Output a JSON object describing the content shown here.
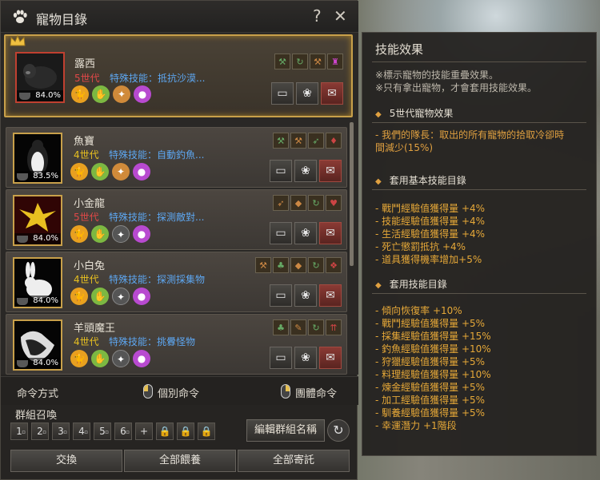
{
  "window": {
    "title": "寵物目錄",
    "help": "?",
    "close": "✕"
  },
  "pets": [
    {
      "name": "露西",
      "generation": "5世代",
      "gen_color": "#e04848",
      "special": "特殊技能：抵抗沙漠...",
      "loyalty": "84.0%",
      "selected": true
    },
    {
      "name": "魚寶",
      "generation": "4世代",
      "gen_color": "#e8c020",
      "special": "特殊技能：自動釣魚...",
      "loyalty": "83.5%",
      "selected": false
    },
    {
      "name": "小金龍",
      "generation": "5世代",
      "gen_color": "#e04848",
      "special": "特殊技能：探測敵對...",
      "loyalty": "84.0%",
      "selected": false
    },
    {
      "name": "小白兔",
      "generation": "4世代",
      "gen_color": "#e8c020",
      "special": "特殊技能：探測採集物",
      "loyalty": "84.0%",
      "selected": false
    },
    {
      "name": "羊頭魔王",
      "generation": "4世代",
      "gen_color": "#e8c020",
      "special": "特殊技能：挑釁怪物",
      "loyalty": "84.0%",
      "selected": false
    }
  ],
  "command": {
    "label": "命令方式",
    "individual": "個別命令",
    "group": "團體命令"
  },
  "group": {
    "label": "群組召喚",
    "slots": [
      "1",
      "2",
      "3",
      "4",
      "5",
      "6",
      "+"
    ],
    "edit_button": "編輯群組名稱",
    "refresh": "↻"
  },
  "bottom": {
    "exchange": "交換",
    "feed_all": "全部餵養",
    "deposit_all": "全部寄託"
  },
  "skill_panel": {
    "title": "技能效果",
    "notes": [
      "※標示寵物的技能重疊效果。",
      "※只有拿出寵物，才會套用技能效果。"
    ],
    "section1": "5世代寵物效果",
    "section1_lines": [
      "- 我們的隊長：取出的所有寵物的拾取冷卻時",
      "間減少(15%)"
    ],
    "section2": "套用基本技能目錄",
    "section2_lines": [
      "- 戰鬥經驗值獲得量 +4%",
      "- 技能經驗值獲得量 +4%",
      "- 生活經驗值獲得量 +4%",
      "- 死亡懲罰抵抗 +4%",
      "- 道具獲得機率增加+5%"
    ],
    "section3": "套用技能目錄",
    "section3_lines": [
      "- 傾向恢復率 +10%",
      "- 戰鬥經驗值獲得量 +5%",
      "- 採集經驗值獲得量 +15%",
      "- 釣魚經驗值獲得量 +10%",
      "- 狩獵經驗值獲得量 +5%",
      "- 料理經驗值獲得量 +10%",
      "- 煉金經驗值獲得量 +5%",
      "- 加工經驗值獲得量 +5%",
      "- 馴養經驗值獲得量 +5%",
      "- 幸運潛力 +1階段"
    ]
  }
}
